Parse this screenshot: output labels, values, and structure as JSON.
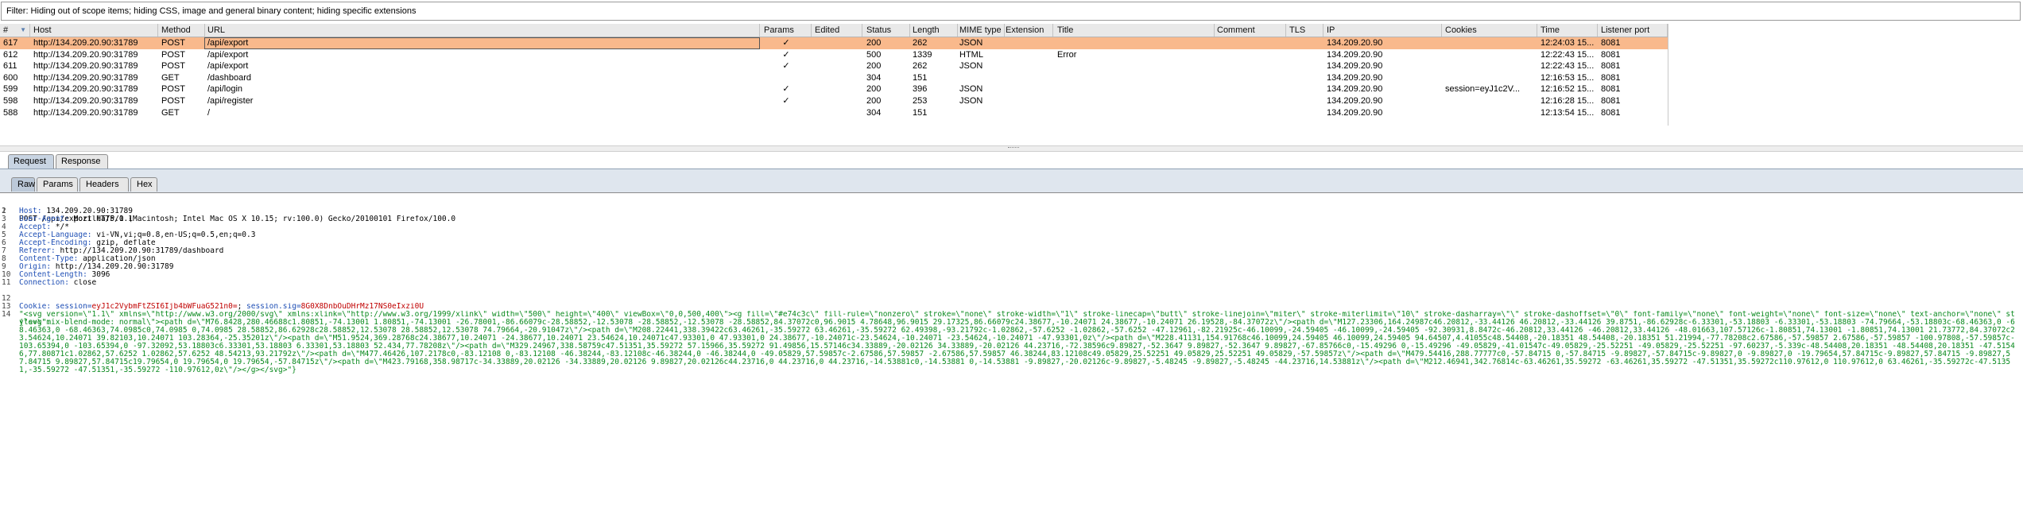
{
  "filter": {
    "text": "Filter: Hiding out of scope items;  hiding CSS, image and general binary content;  hiding specific extensions"
  },
  "history": {
    "columns": [
      {
        "label": "#"
      },
      {
        "label": "Host"
      },
      {
        "label": "Method"
      },
      {
        "label": "URL"
      },
      {
        "label": "Params"
      },
      {
        "label": "Edited"
      },
      {
        "label": "Status"
      },
      {
        "label": "Length"
      },
      {
        "label": "MIME type"
      },
      {
        "label": "Extension"
      },
      {
        "label": "Title"
      },
      {
        "label": "Comment"
      },
      {
        "label": "TLS"
      },
      {
        "label": "IP"
      },
      {
        "label": "Cookies"
      },
      {
        "label": "Time"
      },
      {
        "label": "Listener port"
      }
    ],
    "sort_glyph": "▼",
    "rows": [
      {
        "num": "617",
        "host": "http://134.209.20.90:31789",
        "method": "POST",
        "url": "/api/export",
        "params": "✓",
        "edited": "",
        "status": "200",
        "length": "262",
        "mime": "JSON",
        "ext": "",
        "title": "",
        "comment": "",
        "tls": "",
        "ip": "134.209.20.90",
        "cookies": "",
        "time": "12:24:03 15...",
        "port": "8081"
      },
      {
        "num": "612",
        "host": "http://134.209.20.90:31789",
        "method": "POST",
        "url": "/api/export",
        "params": "✓",
        "edited": "",
        "status": "500",
        "length": "1339",
        "mime": "HTML",
        "ext": "",
        "title": "Error",
        "comment": "",
        "tls": "",
        "ip": "134.209.20.90",
        "cookies": "",
        "time": "12:22:43 15...",
        "port": "8081"
      },
      {
        "num": "611",
        "host": "http://134.209.20.90:31789",
        "method": "POST",
        "url": "/api/export",
        "params": "✓",
        "edited": "",
        "status": "200",
        "length": "262",
        "mime": "JSON",
        "ext": "",
        "title": "",
        "comment": "",
        "tls": "",
        "ip": "134.209.20.90",
        "cookies": "",
        "time": "12:22:43 15...",
        "port": "8081"
      },
      {
        "num": "600",
        "host": "http://134.209.20.90:31789",
        "method": "GET",
        "url": "/dashboard",
        "params": "",
        "edited": "",
        "status": "304",
        "length": "151",
        "mime": "",
        "ext": "",
        "title": "",
        "comment": "",
        "tls": "",
        "ip": "134.209.20.90",
        "cookies": "",
        "time": "12:16:53 15...",
        "port": "8081"
      },
      {
        "num": "599",
        "host": "http://134.209.20.90:31789",
        "method": "POST",
        "url": "/api/login",
        "params": "✓",
        "edited": "",
        "status": "200",
        "length": "396",
        "mime": "JSON",
        "ext": "",
        "title": "",
        "comment": "",
        "tls": "",
        "ip": "134.209.20.90",
        "cookies": "session=eyJ1c2V...",
        "time": "12:16:52 15...",
        "port": "8081"
      },
      {
        "num": "598",
        "host": "http://134.209.20.90:31789",
        "method": "POST",
        "url": "/api/register",
        "params": "✓",
        "edited": "",
        "status": "200",
        "length": "253",
        "mime": "JSON",
        "ext": "",
        "title": "",
        "comment": "",
        "tls": "",
        "ip": "134.209.20.90",
        "cookies": "",
        "time": "12:16:28 15...",
        "port": "8081"
      },
      {
        "num": "588",
        "host": "http://134.209.20.90:31789",
        "method": "GET",
        "url": "/",
        "params": "",
        "edited": "",
        "status": "304",
        "length": "151",
        "mime": "",
        "ext": "",
        "title": "",
        "comment": "",
        "tls": "",
        "ip": "134.209.20.90",
        "cookies": "",
        "time": "12:13:54 15...",
        "port": "8081"
      }
    ]
  },
  "tabs": {
    "request": "Request",
    "response": "Response"
  },
  "subtabs": {
    "raw": "Raw",
    "params": "Params",
    "headers": "Headers",
    "hex": "Hex"
  },
  "request": {
    "line_numbers": [
      "1",
      "2",
      "3",
      "4",
      "5",
      "6",
      "7",
      "8",
      "9",
      "10",
      "11",
      "12",
      "13",
      "14"
    ],
    "request_line": "POST /api/export HTTP/1.1",
    "headers": [
      {
        "name": "Host:",
        "value": " 134.209.20.90:31789"
      },
      {
        "name": "User-Agent:",
        "value": " Mozilla/5.0 (Macintosh; Intel Mac OS X 10.15; rv:100.0) Gecko/20100101 Firefox/100.0"
      },
      {
        "name": "Accept:",
        "value": " */*"
      },
      {
        "name": "Accept-Language:",
        "value": " vi-VN,vi;q=0.8,en-US;q=0.5,en;q=0.3"
      },
      {
        "name": "Accept-Encoding:",
        "value": " gzip, deflate"
      },
      {
        "name": "Referer:",
        "value": " http://134.209.20.90:31789/dashboard"
      },
      {
        "name": "Content-Type:",
        "value": " application/json"
      },
      {
        "name": "Origin:",
        "value": " http://134.209.20.90:31789"
      },
      {
        "name": "Content-Length:",
        "value": " 3096"
      },
      {
        "name": "Connection:",
        "value": " close"
      }
    ],
    "cookie": {
      "name": "Cookie:",
      "k1": " session=",
      "v1": "eyJ1c2VybmFtZSI6Ijb4bWFuaG521n0=",
      "sep": "; ",
      "k2": "session.sig",
      "eq": "=",
      "v2": "8G0X8DnbOuDHrMz17NS0eIxzi0U"
    },
    "body_open": "{\"svg\":",
    "body": "\"<svg version=\\\"1.1\\\" xmlns=\\\"http://www.w3.org/2000/svg\\\" xmlns:xlink=\\\"http://www.w3.org/1999/xlink\\\" width=\\\"500\\\" height=\\\"400\\\" viewBox=\\\"0,0,500,400\\\"><g fill=\\\"#e74c3c\\\" fill-rule=\\\"nonzero\\\" stroke=\\\"none\\\" stroke-width=\\\"1\\\" stroke-linecap=\\\"butt\\\" stroke-linejoin=\\\"miter\\\" stroke-miterlimit=\\\"10\\\" stroke-dasharray=\\\"\\\" stroke-dashoffset=\\\"0\\\" font-family=\\\"none\\\" font-weight=\\\"none\\\" font-size=\\\"none\\\" text-anchor=\\\"none\\\" style=\\\"mix-blend-mode: normal\\\"><path d=\\\"M76.8428,280.46688c1.80851,-74.13001 1.80851,-74.13001 -26.78001,-86.66079c-28.58852,-12.53078 -28.58852,-12.53078 -28.58852,84.37072c0,96.9015 4.78648,96.9015 29.17325,86.66079c24.38677,-10.24071 24.38677,-10.24071 26.19528,-84.37072z\\\"/><path d=\\\"M127.23306,164.24987c46.20812,-33.44126 46.20812,-33.44126 39.8751,-86.62928c-6.33301,-53.18803 -6.33301,-53.18803 -74.79664,-53.18803c-68.46363,0 -68.46363,0 -68.46363,74.0985c0,74.0985 0,74.0985 28.58852,86.62928c28.58852,12.53078 28.58852,12.53078 74.79664,-20.91047z\\\"/><path d=\\\"M208.22441,338.39422c63.46261,-35.59272 63.46261,-35.59272 62.49398,-93.21792c-1.02862,-57.6252 -1.02862,-57.6252 -47.12961,-82.21925c-46.10099,-24.59405 -46.10099,-24.59405 -92.30931,8.8472c-46.20812,33.44126 -46.20812,33.44126 -48.01663,107.57126c-1.80851,74.13001 -1.80851,74.13001 21.73772,84.37072c23.54624,10.24071 39.82103,10.24071 103.28364,-25.35201z\\\"/><path d=\\\"M51.9524,369.28768c24.38677,10.24071 -24.38677,10.24071 23.54624,10.24071c47.93301,0 47.93301,0 24.38677,-10.24071c-23.54624,-10.24071 -23.54624,-10.24071 -47.93301,0z\\\"/><path d=\\\"M228.41131,154.91768c46.10099,24.59405 46.10099,24.59405 94.64507,4.41055c48.54408,-20.18351 48.54408,-20.18351 51.21994,-77.78208c2.67586,-57.59857 2.67586,-57.59857 -100.97808,-57.59857c-103.65394,0 -103.65394,0 -97.32092,53.18803c6.33301,53.18803 6.33301,53.18803 52.434,77.78208z\\\"/><path d=\\\"M329.24967,338.58759c47.51351,35.59272 57.15966,35.59272 91.49856,15.57146c34.33889,-20.02126 34.33889,-20.02126 44.23716,-72.38596c9.89827,-52.3647 9.89827,-52.3647 9.89827,-67.85766c0,-15.49296 0,-15.49296 -49.05829,-41.01547c-49.05829,-25.52251 -49.05829,-25.52251 -97.60237,-5.339c-48.54408,20.18351 -48.54408,20.18351 -47.51546,77.80871c1.02862,57.6252 1.02862,57.6252 48.54213,93.21792z\\\"/><path d=\\\"M477.46426,107.2178c0,-83.12108 0,-83.12108 -46.38244,-83.12108c-46.38244,0 -46.38244,0 -49.05829,57.59857c-2.67586,57.59857 -2.67586,57.59857 46.38244,83.12108c49.05829,25.52251 49.05829,25.52251 49.05829,-57.59857z\\\"/><path d=\\\"M479.54416,288.77777c0,-57.84715 0,-57.84715 -9.89827,-57.84715c-9.89827,0 -9.89827,0 -19.79654,57.84715c-9.89827,57.84715 -9.89827,57.84715 9.89827,57.84715c19.79654,0 19.79654,0 19.79654,-57.84715z\\\"/><path d=\\\"M423.79168,358.98717c-34.33889,20.02126 -34.33889,20.02126 9.89827,20.02126c44.23716,0 44.23716,0 44.23716,-14.53881c0,-14.53881 0,-14.53881 -9.89827,-20.02126c-9.89827,-5.48245 -9.89827,-5.48245 -44.23716,14.53881z\\\"/><path d=\\\"M212.46941,342.76814c-63.46261,35.59272 -63.46261,35.59272 -47.51351,35.59272c110.97612,0 110.97612,0 63.46261,-35.59272c-47.51351,-35.59272 -47.51351,-35.59272 -110.97612,0z\\\"/></g></svg>\"}"
  }
}
